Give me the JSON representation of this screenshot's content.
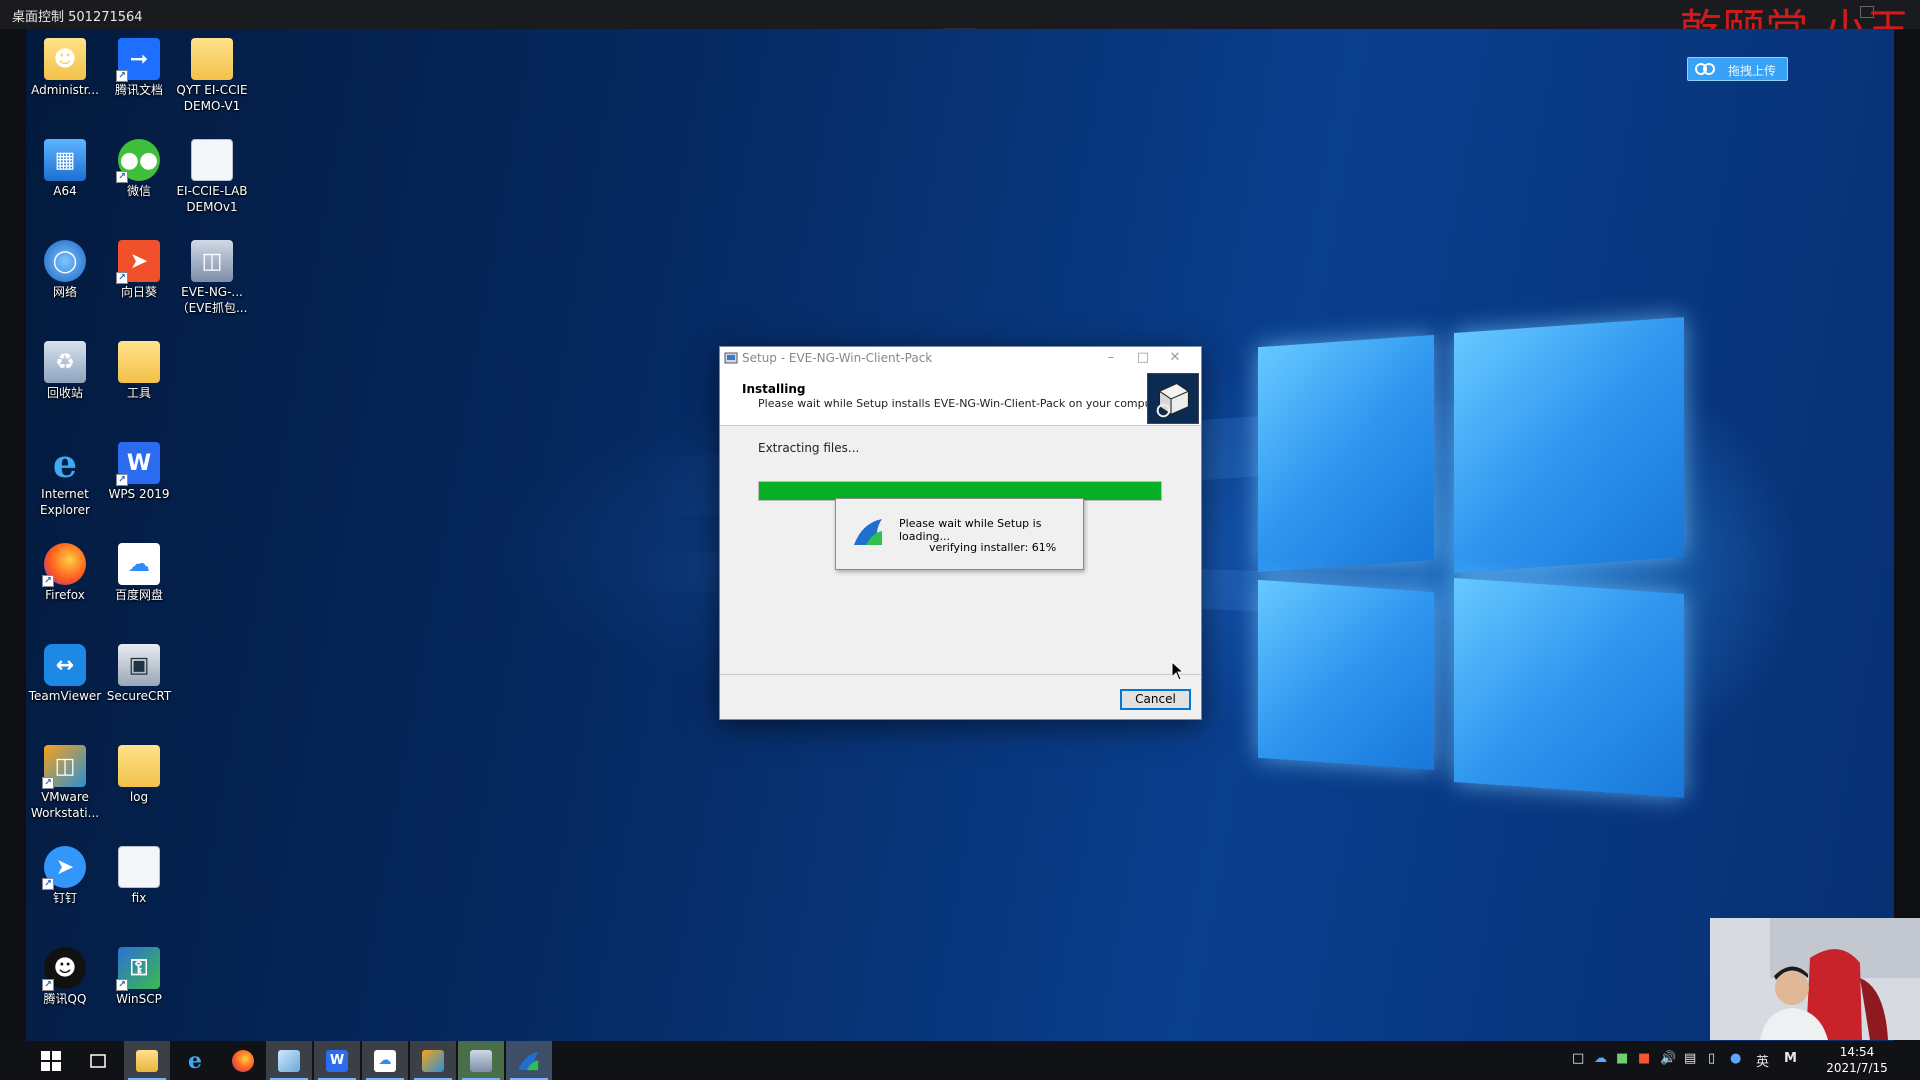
{
  "remote": {
    "title": "桌面控制 501271564",
    "watermark": "乾颐堂-小王",
    "upload_label": "拖拽上传"
  },
  "desktop_icons": [
    {
      "label": "Administr...",
      "icon": "user-folder-icon"
    },
    {
      "label": "腾讯文档",
      "icon": "tencent-docs-icon"
    },
    {
      "label": "QYT EI-CCIE\nDEMO-V1",
      "icon": "folder-icon"
    },
    {
      "label": "A64",
      "icon": "computer-icon"
    },
    {
      "label": "微信",
      "icon": "wechat-icon"
    },
    {
      "label": "EI-CCIE-LAB\nDEMOv1",
      "icon": "document-icon"
    },
    {
      "label": "网络",
      "icon": "network-icon"
    },
    {
      "label": "向日葵",
      "icon": "sunflower-icon"
    },
    {
      "label": "EVE-NG-...\n（EVE抓包...",
      "icon": "installer-icon"
    },
    {
      "label": "回收站",
      "icon": "recycle-bin-icon"
    },
    {
      "label": "工具",
      "icon": "folder-icon"
    },
    {
      "label": "Internet\nExplorer",
      "icon": "ie-icon"
    },
    {
      "label": "WPS 2019",
      "icon": "wps-icon"
    },
    {
      "label": "Firefox",
      "icon": "firefox-icon"
    },
    {
      "label": "百度网盘",
      "icon": "baidu-netdisk-icon"
    },
    {
      "label": "TeamViewer",
      "icon": "teamviewer-icon"
    },
    {
      "label": "SecureCRT",
      "icon": "securecrt-icon"
    },
    {
      "label": "VMware\nWorkstati...",
      "icon": "vmware-icon"
    },
    {
      "label": "log",
      "icon": "folder-icon"
    },
    {
      "label": "钉钉",
      "icon": "dingtalk-icon"
    },
    {
      "label": "fix",
      "icon": "document-icon"
    },
    {
      "label": "腾讯QQ",
      "icon": "qq-icon"
    },
    {
      "label": "WinSCP",
      "icon": "winscp-icon"
    }
  ],
  "dialog": {
    "title": "Setup - EVE-NG-Win-Client-Pack",
    "header_title": "Installing",
    "header_subtitle": "Please wait while Setup installs EVE-NG-Win-Client-Pack on your computer.",
    "status": "Extracting files...",
    "progress_fraction": 1.0,
    "cancel_label": "Cancel",
    "loading_line1": "Please wait while Setup is loading...",
    "loading_line2": "verifying installer: 61%"
  },
  "taskbar": {
    "apps": [
      "start-icon",
      "task-view-icon",
      "file-explorer-icon",
      "edge-ie-icon",
      "firefox-icon",
      "notepad-icon",
      "wps-icon",
      "baidu-netdisk-icon",
      "vmware-icon",
      "setup-icon",
      "eve-icon"
    ],
    "ime": "英",
    "ime2": "M",
    "time": "14:54",
    "date": "2021/7/15"
  },
  "colors": {
    "progress": "#06b025",
    "watermark": "#d21a1a",
    "accent": "#0078d7"
  }
}
